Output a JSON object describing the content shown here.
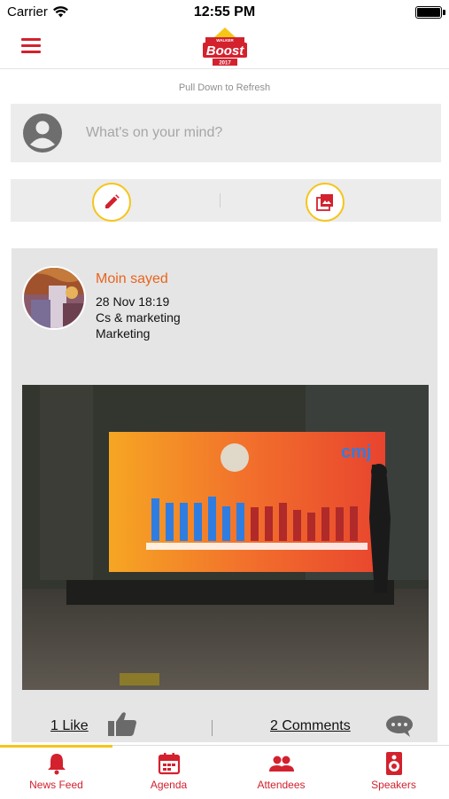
{
  "status_bar": {
    "carrier": "Carrier",
    "time": "12:55 PM"
  },
  "nav": {
    "logo_text": "Boost",
    "logo_small_text": "WALKER",
    "logo_year": "2017",
    "icon": "hamburger-menu-icon"
  },
  "feed": {
    "pull_to_refresh": "Pull Down to Refresh",
    "composer_placeholder": "What's on your mind?",
    "actions": [
      "pencil-icon",
      "photo-library-icon"
    ]
  },
  "post": {
    "author": "Moin sayed",
    "date": "28 Nov 18:19",
    "department": "Cs & marketing",
    "role": "Marketing",
    "likes_label": "1 Like",
    "comments_label": "2 Comments",
    "photo_screen_text": "cmj"
  },
  "tabs": [
    {
      "label": "News Feed",
      "icon": "bell-icon"
    },
    {
      "label": "Agenda",
      "icon": "calendar-icon"
    },
    {
      "label": "Attendees",
      "icon": "people-icon"
    },
    {
      "label": "Speakers",
      "icon": "speaker-icon"
    }
  ],
  "colors": {
    "brand_red": "#d3212e",
    "accent_yellow": "#f5c518",
    "author_orange": "#e8641e",
    "card_gray": "#e5e5e5"
  }
}
